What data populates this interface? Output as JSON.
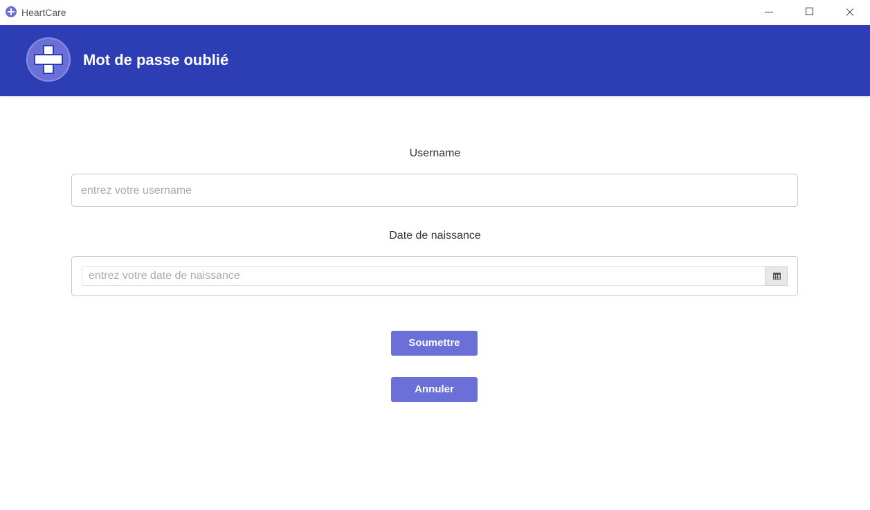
{
  "window": {
    "app_title": "HeartCare",
    "controls": [
      "minimize",
      "maximize",
      "close"
    ]
  },
  "header": {
    "title": "Mot de passe oublié",
    "logo_icon": "medical-cross-icon",
    "background_color": "#2d3eb4",
    "accent_color": "#6b70d8"
  },
  "form": {
    "username_label": "Username",
    "username_placeholder": "entrez votre username",
    "username_value": "",
    "dob_label": "Date de naissance",
    "dob_placeholder": "entrez votre date de naissance",
    "dob_value": "",
    "dob_picker_icon": "calendar-icon",
    "submit_label": "Soumettre",
    "cancel_label": "Annuler"
  }
}
